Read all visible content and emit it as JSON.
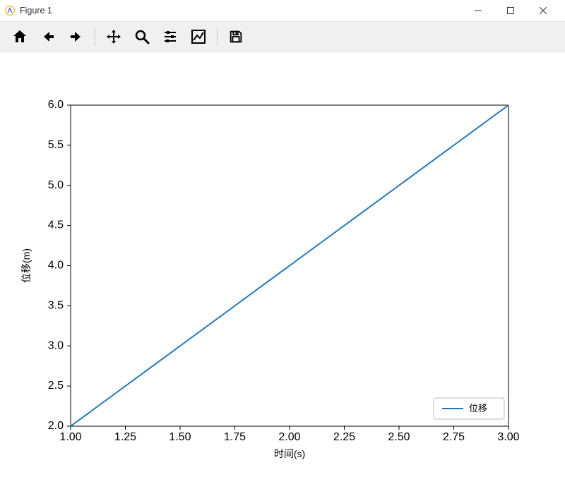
{
  "window": {
    "title": "Figure 1"
  },
  "toolbar": {
    "items": [
      "home",
      "back",
      "forward",
      "|",
      "pan",
      "zoom",
      "configure",
      "subplots",
      "|",
      "save"
    ]
  },
  "chart_data": {
    "type": "line",
    "x": [
      1.0,
      1.25,
      1.5,
      1.75,
      2.0,
      2.25,
      2.5,
      2.75,
      3.0
    ],
    "series": [
      {
        "name": "位移",
        "values": [
          2.0,
          2.5,
          3.0,
          3.5,
          4.0,
          4.5,
          5.0,
          5.5,
          6.0
        ]
      }
    ],
    "xlabel": "时间(s)",
    "ylabel": "位移(m)",
    "xticks": [
      1.0,
      1.25,
      1.5,
      1.75,
      2.0,
      2.25,
      2.5,
      2.75,
      3.0
    ],
    "yticks": [
      2.0,
      2.5,
      3.0,
      3.5,
      4.0,
      4.5,
      5.0,
      5.5,
      6.0
    ],
    "xlim": [
      1.0,
      3.0
    ],
    "ylim": [
      2.0,
      6.0
    ],
    "legend": {
      "position": "lower right",
      "entries": [
        "位移"
      ]
    }
  }
}
